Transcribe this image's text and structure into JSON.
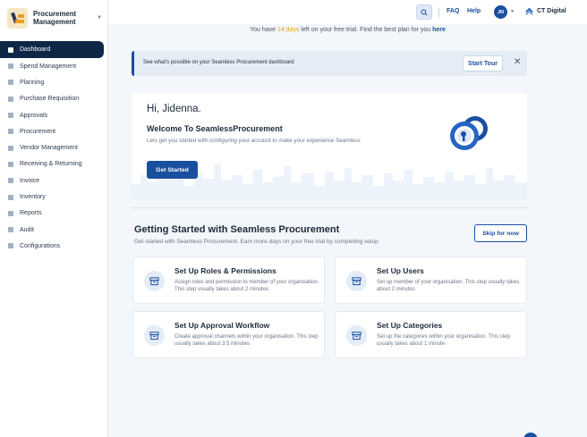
{
  "sidebar": {
    "brand": "Procurement Management",
    "items": [
      {
        "label": "Dashboard",
        "icon": "dashboard-icon",
        "active": true
      },
      {
        "label": "Spend Management",
        "icon": "wallet-icon"
      },
      {
        "label": "Planning",
        "icon": "document-icon"
      },
      {
        "label": "Purchase Requisition",
        "icon": "cart-icon"
      },
      {
        "label": "Approvals",
        "icon": "check-icon"
      },
      {
        "label": "Procurement",
        "icon": "list-icon"
      },
      {
        "label": "Vendor Management",
        "icon": "truck-icon"
      },
      {
        "label": "Receiving & Returning",
        "icon": "box-icon"
      },
      {
        "label": "Invoice",
        "icon": "invoice-icon"
      },
      {
        "label": "Inventory",
        "icon": "inventory-icon"
      },
      {
        "label": "Reports",
        "icon": "report-icon"
      },
      {
        "label": "Audit",
        "icon": "audit-icon"
      },
      {
        "label": "Configurations",
        "icon": "settings-icon"
      }
    ]
  },
  "topbar": {
    "faq": "FAQ",
    "help": "Help",
    "avatar_initials": "JN",
    "org_name": "CT Digital"
  },
  "trial": {
    "prefix": "You have ",
    "days": "14 days",
    "middle": " left on your free trial. Find the best plan for you ",
    "link": "here"
  },
  "tour": {
    "text": "See what's possible on your Seamless Procurement dashboard",
    "button": "Start Tour",
    "close": "✕"
  },
  "welcome": {
    "greeting": "Hi, Jidenna.",
    "title": "Welcome To SeamlessProcurement",
    "subtitle": "Lets get you started with configuring your account to make your experience Seamless",
    "button": "Get Started"
  },
  "getting_started": {
    "title": "Getting Started with Seamless Procurement",
    "subtitle": "Get started with Seamless Procurement. Earn more days on your free trial by completing setup",
    "skip": "Skip for now",
    "cards": [
      {
        "title": "Set Up Roles & Permissions",
        "desc": "Assign roles and permission to member of your organisation. This step usually takes about 2 minutes"
      },
      {
        "title": "Set Up Users",
        "desc": "Set up member of your organisation. This step usually takes about 2 minutes"
      },
      {
        "title": "Set Up Approval Workflow",
        "desc": "Create approval channels within your organisation. This step usually takes about 3.5 minutes"
      },
      {
        "title": "Set Up Categories",
        "desc": "Set up the categories within your organisation. This step usually takes about 1 minute"
      }
    ]
  },
  "colors": {
    "primary": "#1a4fa0",
    "sidebar_active": "#0f2747",
    "accent": "#e9a21d"
  }
}
